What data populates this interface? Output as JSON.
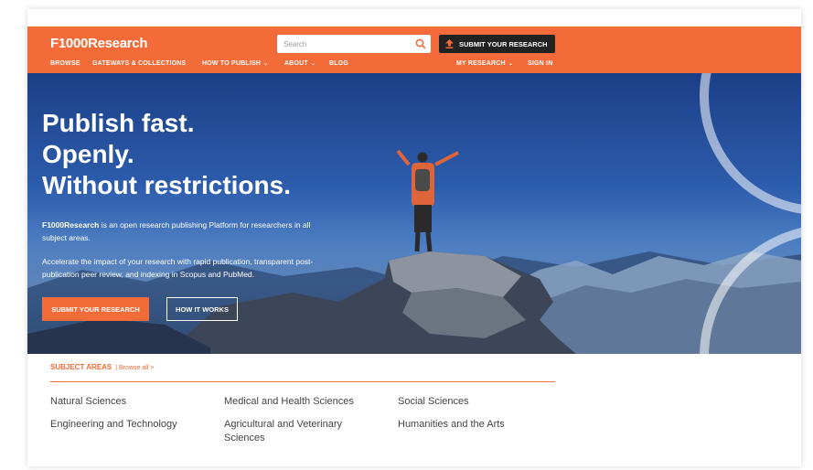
{
  "header": {
    "logo": "F1000Research",
    "search": {
      "placeholder": "Search",
      "value": ""
    },
    "submit_label": "SUBMIT YOUR RESEARCH",
    "nav": {
      "browse": "BROWSE",
      "gateways": "GATEWAYS & COLLECTIONS",
      "how_to_publish": "HOW TO PUBLISH",
      "about": "ABOUT",
      "blog": "BLOG",
      "my_research": "MY RESEARCH",
      "sign_in": "SIGN IN"
    }
  },
  "hero": {
    "title_lines": [
      "Publish fast.",
      "Openly.",
      "Without restrictions."
    ],
    "brand": "F1000Research",
    "para1_rest": " is an open research publishing Platform for researchers in all subject areas.",
    "para2": "Accelerate the impact of your research with rapid publication, transparent post-publication peer review, and indexing in Scopus and PubMed.",
    "submit_label": "SUBMIT YOUR RESEARCH",
    "how_label": "HOW IT WORKS"
  },
  "subjects": {
    "title": "SUBJECT AREAS",
    "browse_all": "| Browse all >",
    "items": [
      "Natural Sciences",
      "Medical and Health Sciences",
      "Social Sciences",
      "Engineering and Technology",
      "Agricultural and Veterinary Sciences",
      "Humanities and the Arts"
    ]
  },
  "colors": {
    "brand_orange": "#f26b38",
    "dark_button": "#222222",
    "text_gray": "#444444"
  }
}
